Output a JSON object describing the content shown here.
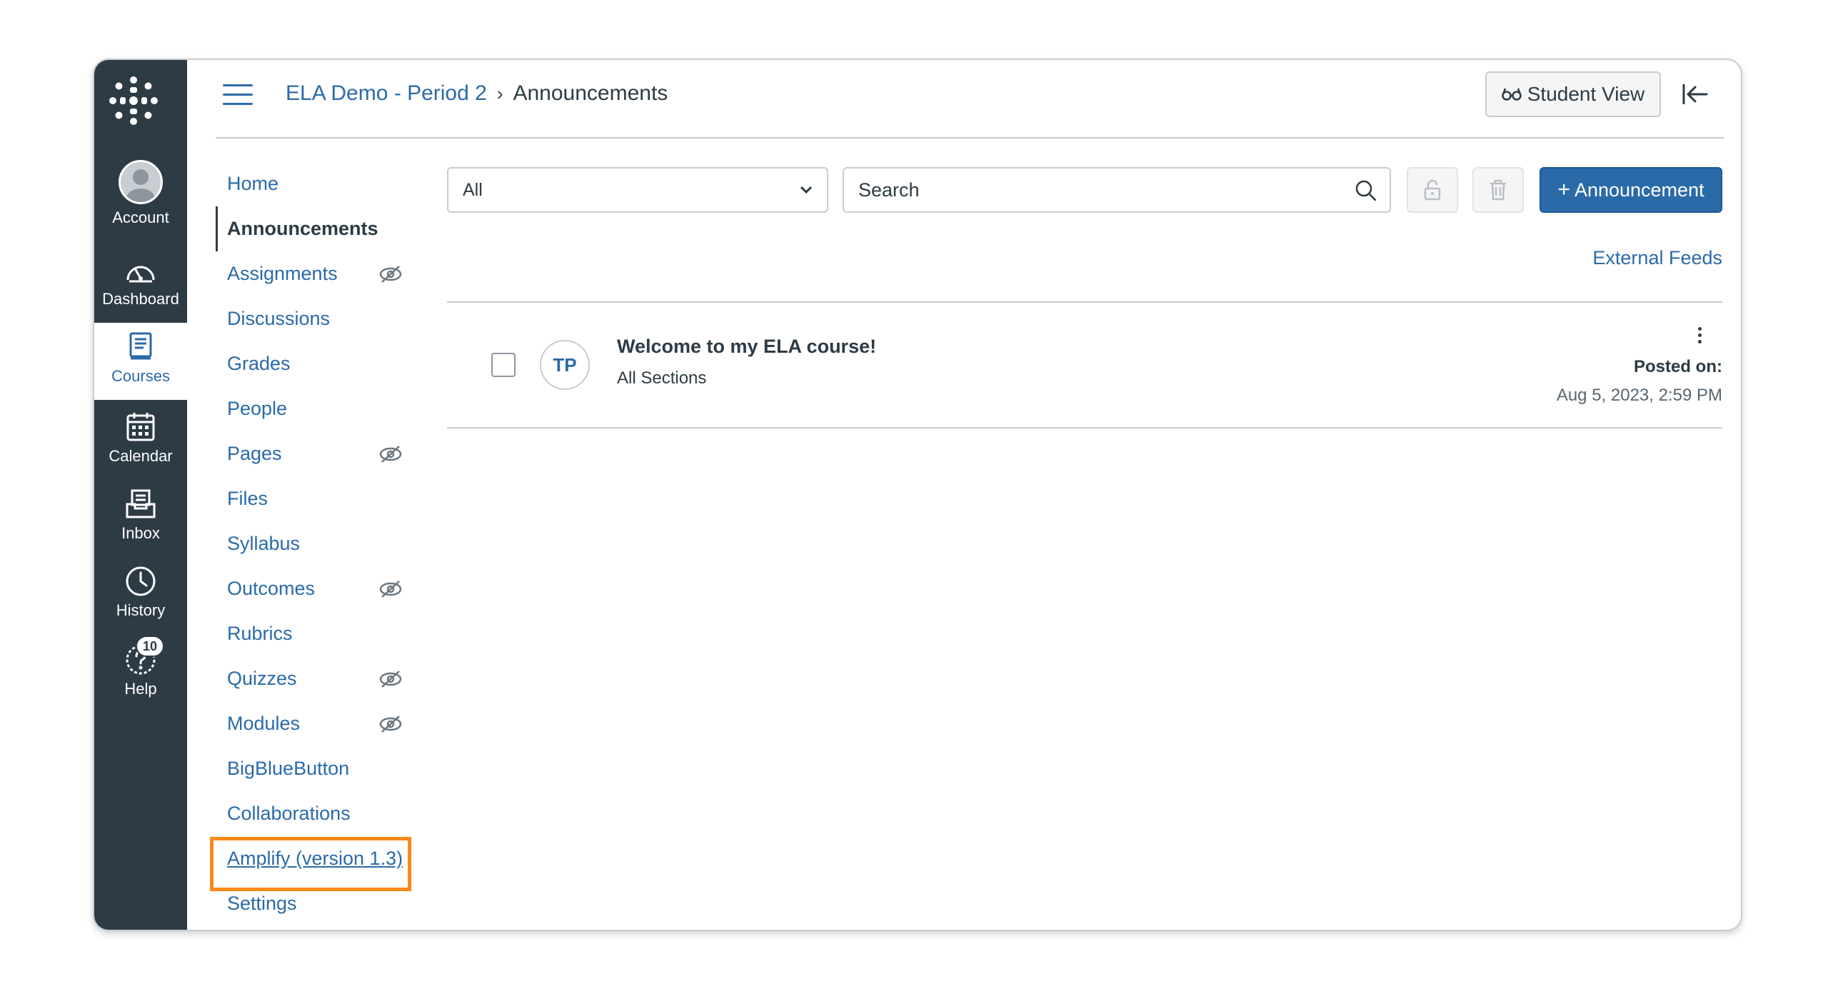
{
  "global_nav": {
    "items": [
      {
        "label": "Account",
        "icon": "account-avatar-icon"
      },
      {
        "label": "Dashboard",
        "icon": "speedometer-icon"
      },
      {
        "label": "Courses",
        "icon": "book-icon",
        "active": true
      },
      {
        "label": "Calendar",
        "icon": "calendar-icon"
      },
      {
        "label": "Inbox",
        "icon": "inbox-icon"
      },
      {
        "label": "History",
        "icon": "clock-icon"
      },
      {
        "label": "Help",
        "icon": "help-icon",
        "badge": "10"
      }
    ],
    "colors": {
      "background": "#2d3b45",
      "active_bg": "#ffffff",
      "active_text": "#2b6aa9"
    }
  },
  "header": {
    "course_link": "ELA Demo - Period 2",
    "separator": "›",
    "current": "Announcements",
    "student_view_label": "Student View"
  },
  "course_nav": {
    "items": [
      {
        "label": "Home"
      },
      {
        "label": "Announcements",
        "active": true
      },
      {
        "label": "Assignments",
        "hidden": true
      },
      {
        "label": "Discussions"
      },
      {
        "label": "Grades"
      },
      {
        "label": "People"
      },
      {
        "label": "Pages",
        "hidden": true
      },
      {
        "label": "Files"
      },
      {
        "label": "Syllabus"
      },
      {
        "label": "Outcomes",
        "hidden": true
      },
      {
        "label": "Rubrics"
      },
      {
        "label": "Quizzes",
        "hidden": true
      },
      {
        "label": "Modules",
        "hidden": true
      },
      {
        "label": "BigBlueButton"
      },
      {
        "label": "Collaborations"
      },
      {
        "label": "Amplify (version 1.3)",
        "highlighted": true
      },
      {
        "label": "Settings"
      }
    ],
    "highlight_color": "#f98a18"
  },
  "toolbar": {
    "filter_value": "All",
    "search_placeholder": "Search",
    "add_button_plus": "+",
    "add_button_label": "Announcement",
    "external_feeds": "External Feeds",
    "accent": "#2b6aa9"
  },
  "announcements": [
    {
      "initials": "TP",
      "title": "Welcome to my ELA course!",
      "sections": "All Sections",
      "posted_label": "Posted on:",
      "posted_date": "Aug 5, 2023, 2:59 PM"
    }
  ]
}
